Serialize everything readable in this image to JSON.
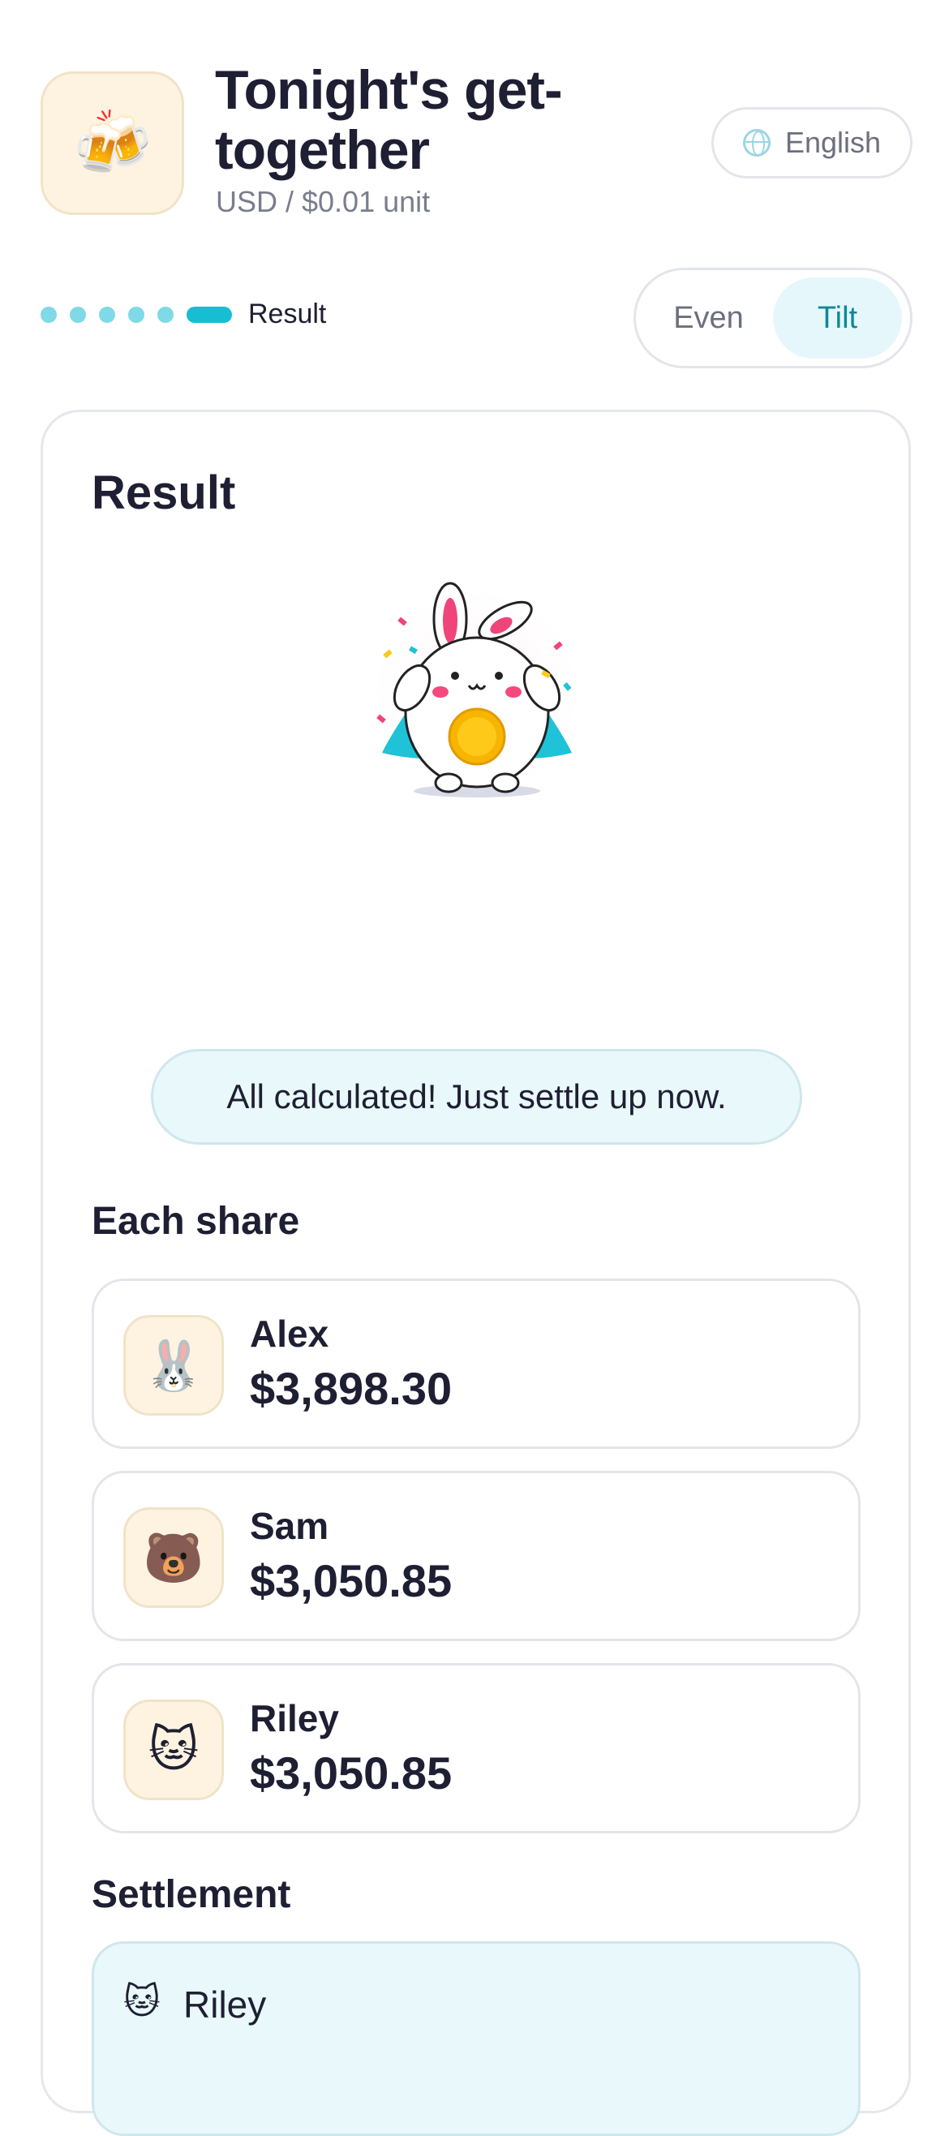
{
  "header": {
    "app_icon": "beer-mugs-icon",
    "title": "Tonight's get-together",
    "subtitle": "USD / $0.01 unit",
    "language_label": "English",
    "language_icon": "globe-icon"
  },
  "progress": {
    "total_steps": 6,
    "current_step": 6,
    "current_label": "Result",
    "colors": {
      "done": "#7fd9e6",
      "active": "#16bdd3"
    }
  },
  "mode_toggle": {
    "options": [
      "Even",
      "Tilt"
    ],
    "selected": "Tilt"
  },
  "result": {
    "title": "Result",
    "mascot": "bunny-holding-coin-illustration",
    "message": "All calculated! Just settle up now.",
    "shares_heading": "Each share",
    "shares": [
      {
        "name": "Alex",
        "amount": "$3,898.30",
        "avatar": "rabbit-face-icon",
        "emoji": "🐰"
      },
      {
        "name": "Sam",
        "amount": "$3,050.85",
        "avatar": "bear-face-icon",
        "emoji": "🐻"
      },
      {
        "name": "Riley",
        "amount": "$3,050.85",
        "avatar": "cat-face-icon",
        "emoji": "🐱"
      }
    ],
    "settlement_heading": "Settlement",
    "settlement": {
      "name": "Riley",
      "avatar": "cat-face-icon",
      "emoji": "🐱"
    }
  },
  "colors": {
    "accent": "#16bdd3",
    "accent_text": "#0e8996",
    "highlight_bg": "#e9f8fb",
    "avatar_bg": "#fdf3e0",
    "text": "#1e1f33",
    "muted": "#7a7d8c"
  }
}
